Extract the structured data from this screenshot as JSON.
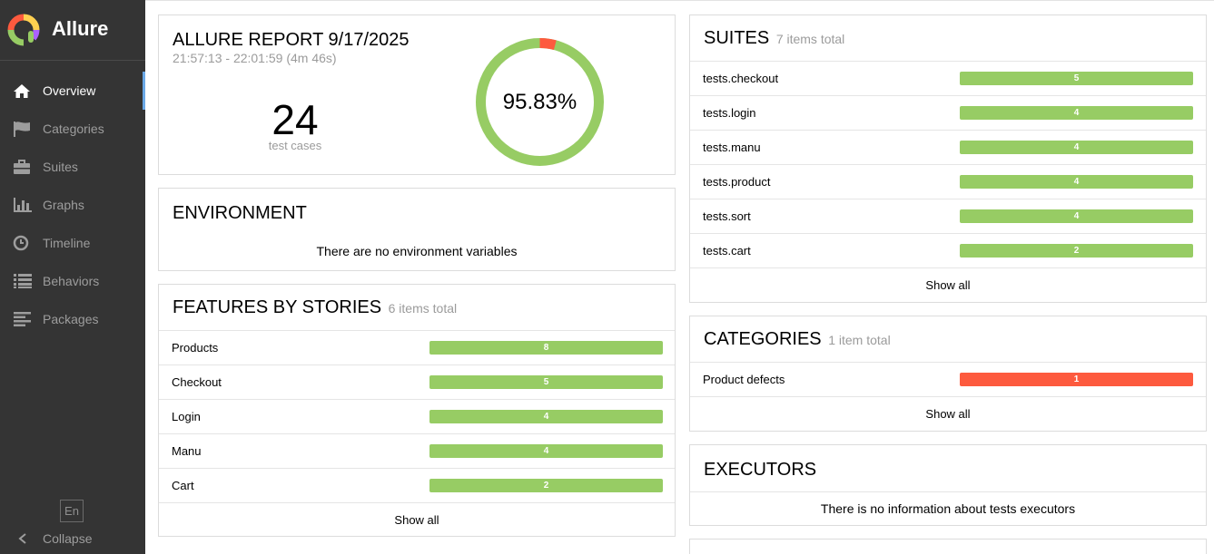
{
  "app": {
    "name": "Allure"
  },
  "nav": [
    {
      "label": "Overview",
      "icon": "home-icon",
      "active": true
    },
    {
      "label": "Categories",
      "icon": "flag-icon"
    },
    {
      "label": "Suites",
      "icon": "briefcase-icon"
    },
    {
      "label": "Graphs",
      "icon": "bar-chart-icon"
    },
    {
      "label": "Timeline",
      "icon": "clock-icon"
    },
    {
      "label": "Behaviors",
      "icon": "list-icon"
    },
    {
      "label": "Packages",
      "icon": "align-left-icon"
    }
  ],
  "footer": {
    "language": "En",
    "collapse": "Collapse"
  },
  "summary": {
    "title": "ALLURE REPORT 9/17/2025",
    "time": "21:57:13 - 22:01:59 (4m 46s)",
    "test_count": "24",
    "test_count_label": "test cases",
    "success_rate": "95.83%",
    "success_fraction": 0.9583,
    "colors": {
      "passed": "#97cc64",
      "failed": "#fd5a3e"
    }
  },
  "environment": {
    "title": "ENVIRONMENT",
    "empty": "There are no environment variables"
  },
  "features": {
    "title": "FEATURES BY STORIES",
    "count_label": "6 items total",
    "max": 8,
    "items": [
      {
        "name": "Products",
        "value": "8"
      },
      {
        "name": "Checkout",
        "value": "5"
      },
      {
        "name": "Login",
        "value": "4"
      },
      {
        "name": "Manu",
        "value": "4"
      },
      {
        "name": "Cart",
        "value": "2"
      }
    ],
    "show_all": "Show all"
  },
  "suites": {
    "title": "SUITES",
    "count_label": "7 items total",
    "items": [
      {
        "name": "tests.checkout",
        "value": "5"
      },
      {
        "name": "tests.login",
        "value": "4"
      },
      {
        "name": "tests.manu",
        "value": "4"
      },
      {
        "name": "tests.product",
        "value": "4"
      },
      {
        "name": "tests.sort",
        "value": "4"
      },
      {
        "name": "tests.cart",
        "value": "2"
      }
    ],
    "show_all": "Show all"
  },
  "categories": {
    "title": "CATEGORIES",
    "count_label": "1 item total",
    "items": [
      {
        "name": "Product defects",
        "value": "1"
      }
    ],
    "show_all": "Show all"
  },
  "executors": {
    "title": "EXECUTORS",
    "empty": "There is no information about tests executors"
  }
}
